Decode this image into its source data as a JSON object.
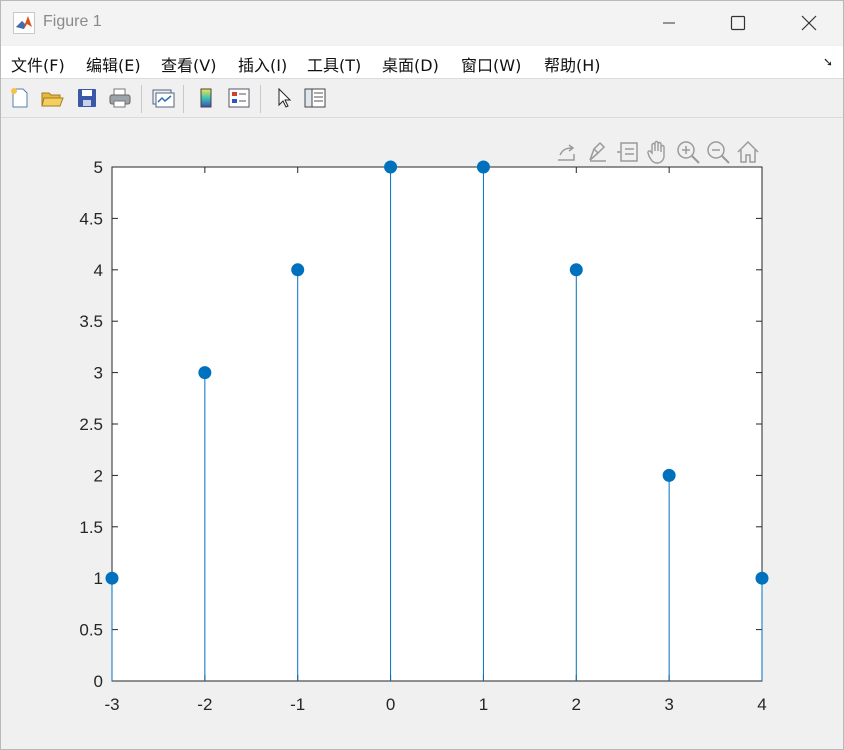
{
  "window": {
    "title": "Figure 1",
    "icon": "matlab-icon",
    "controls": [
      "minimize-icon",
      "maximize-icon",
      "close-icon"
    ]
  },
  "menubar": {
    "items": [
      "文件(F)",
      "编辑(E)",
      "查看(V)",
      "插入(I)",
      "工具(T)",
      "桌面(D)",
      "窗口(W)",
      "帮助(H)"
    ],
    "dock_icon": "dock-arrow-icon",
    "dock_glyph": "➘"
  },
  "toolbar": {
    "buttons": [
      "new-figure-icon",
      "open-file-icon",
      "save-icon",
      "print-icon",
      "link-plot-icon",
      "insert-colorbar-icon",
      "insert-legend-icon",
      "edit-plot-icon",
      "property-inspector-icon"
    ]
  },
  "axes_toolbar": {
    "buttons": [
      "export-icon",
      "brush-icon",
      "data-tips-icon",
      "pan-icon",
      "zoom-in-icon",
      "zoom-out-icon",
      "home-icon"
    ]
  },
  "colors": {
    "stem": "#0072BD",
    "axes_bg": "#ffffff",
    "figure_bg": "#f0f0f0"
  },
  "chart_data": {
    "type": "stem",
    "x": [
      -3,
      -2,
      -1,
      0,
      1,
      2,
      3,
      4
    ],
    "y": [
      1,
      3,
      4,
      5,
      5,
      4,
      2,
      1
    ],
    "xlim": [
      -3,
      4
    ],
    "ylim": [
      0,
      5
    ],
    "xticks": [
      -3,
      -2,
      -1,
      0,
      1,
      2,
      3,
      4
    ],
    "xtick_labels": [
      "-3",
      "-2",
      "-1",
      "0",
      "1",
      "2",
      "3",
      "4"
    ],
    "yticks": [
      0,
      0.5,
      1,
      1.5,
      2,
      2.5,
      3,
      3.5,
      4,
      4.5,
      5
    ],
    "ytick_labels": [
      "0",
      "0.5",
      "1",
      "1.5",
      "2",
      "2.5",
      "3",
      "3.5",
      "4",
      "4.5",
      "5"
    ],
    "title": "",
    "xlabel": "",
    "ylabel": "",
    "grid": false,
    "marker": "filled circle"
  }
}
